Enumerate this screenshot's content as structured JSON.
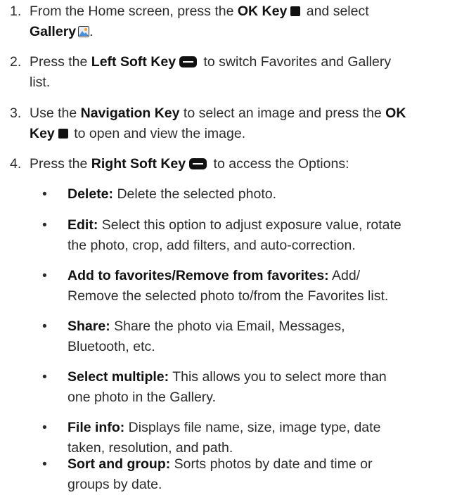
{
  "steps": [
    {
      "number": "1.",
      "p1": "From the Home screen, press the ",
      "b1": "OK Key",
      "p2": " and select",
      "b2": "Gallery",
      "p3": "."
    },
    {
      "number": "2.",
      "p1": "Press the ",
      "b1": "Left Soft Key",
      "p2": " to switch Favorites and Gallery",
      "p3": "list."
    },
    {
      "number": "3.",
      "p1": "Use the ",
      "b1": "Navigation Key",
      "p2": " to select an image and press the ",
      "b2": "OK",
      "b3": "Key",
      "p3": " to open and view the image."
    },
    {
      "number": "4.",
      "p1": "Press the ",
      "b1": "Right Soft Key",
      "p2": " to access the Options:"
    }
  ],
  "bullet_char": "•",
  "options": [
    {
      "term": "Delete:",
      "l1": " Delete the selected photo.",
      "l2": ""
    },
    {
      "term": "Edit:",
      "l1": " Select this option to adjust exposure value, rotate",
      "l2": "the photo, crop, add filters, and auto-correction."
    },
    {
      "term": "Add to favorites/Remove from favorites:",
      "l1": " Add/",
      "l2": "Remove the selected photo to/from the Favorites list."
    },
    {
      "term": "Share:",
      "l1": " Share the photo via Email, Messages,",
      "l2": "Bluetooth, etc."
    },
    {
      "term": "Select multiple:",
      "l1": " This allows you to select more than",
      "l2": "one photo in the Gallery."
    },
    {
      "term": "File info:",
      "l1": " Displays file name, size, image type, date",
      "l2": "taken, resolution, and path."
    },
    {
      "term": "Sort and group:",
      "l1": " Sorts photos by date and time or",
      "l2": "groups by date."
    }
  ],
  "icons": {
    "ok_key": "ok-key-icon",
    "soft_key": "soft-key-icon",
    "gallery": "gallery-icon"
  }
}
